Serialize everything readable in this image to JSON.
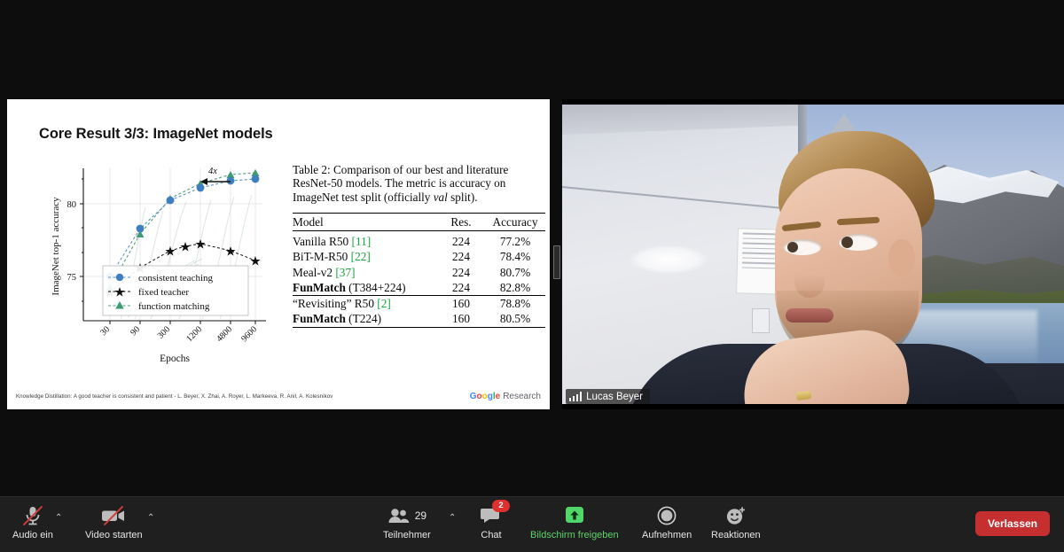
{
  "meeting": {
    "shared_screen_label": "shared-screen",
    "participant_name": "Lucas Beyer"
  },
  "slide": {
    "title": "Core Result 3/3: ImageNet models",
    "footer": "Knowledge Distillation:  A good teacher is consistent and patient - L. Beyer, X. Zhai, A. Royer, L. Markeeva, R. Anil, A. Kolesnikov",
    "logo": {
      "g": "G",
      "o1": "o",
      "o2": "o",
      "g2": "g",
      "l": "l",
      "e": "e",
      "research": "Research"
    }
  },
  "paper": {
    "caption_line1": "Table 2: Comparison of our best and literature",
    "caption_line2": "ResNet-50 models. The metric is accuracy on",
    "caption_line3a": "ImageNet test split (officially ",
    "caption_italic": "val",
    "caption_line3b": " split).",
    "columns": [
      "Model",
      "Res.",
      "Accuracy"
    ],
    "rows": [
      {
        "model": "Vanilla R50",
        "ref": "[11]",
        "res": "224",
        "acc": "77.2%",
        "bold": false
      },
      {
        "model": "BiT-M-R50",
        "ref": "[22]",
        "res": "224",
        "acc": "78.4%",
        "bold": false
      },
      {
        "model": "Meal-v2",
        "ref": "[37]",
        "res": "224",
        "acc": "80.7%",
        "bold": false
      },
      {
        "model": "FunMatch",
        "suffix": "(T384+224)",
        "ref": "",
        "res": "224",
        "acc": "82.8%",
        "bold": true
      }
    ],
    "rows2": [
      {
        "model": "“Revisiting” R50",
        "ref": "[2]",
        "res": "160",
        "acc": "78.8%",
        "bold": false
      },
      {
        "model": "FunMatch",
        "suffix": "(T224)",
        "ref": "",
        "res": "160",
        "acc": "80.5%",
        "bold": true
      }
    ]
  },
  "chart_data": {
    "type": "line",
    "title": "",
    "xlabel": "Epochs",
    "ylabel": "ImageNet top-1 accuracy",
    "x_tick_labels": [
      "30",
      "90",
      "300",
      "1200",
      "4800",
      "9600"
    ],
    "y_tick_labels": [
      "75",
      "80"
    ],
    "ylim": [
      73.2,
      83.6
    ],
    "xlog": true,
    "grid": true,
    "annotation": "4x",
    "legend_position": "lower-right",
    "categories": [
      30,
      90,
      300,
      1200,
      4800,
      9600
    ],
    "series": [
      {
        "name": "consistent teaching",
        "color": "#3f7fbf",
        "marker": "circle",
        "x": [
          30,
          90,
          300,
          1200,
          4800,
          9600
        ],
        "values": [
          75.0,
          78.3,
          80.2,
          81.9,
          82.4,
          82.5
        ]
      },
      {
        "name": "fixed teacher",
        "color": "#111111",
        "marker": "star",
        "x": [
          30,
          90,
          300,
          600,
          1200,
          4800,
          9600
        ],
        "values": [
          74.4,
          76.3,
          77.6,
          77.9,
          78.1,
          77.6,
          76.9
        ]
      },
      {
        "name": "function matching",
        "color": "#3f9b72",
        "marker": "triangle",
        "x": [
          30,
          90,
          300,
          1200,
          4800,
          9600
        ],
        "values": [
          74.4,
          78.0,
          80.4,
          82.2,
          82.9,
          83.0
        ]
      }
    ]
  },
  "toolbar": {
    "audio": {
      "label": "Audio ein",
      "icon": "microphone-muted-icon",
      "caret": "⌃"
    },
    "video": {
      "label": "Video starten",
      "icon": "camera-off-icon",
      "caret": "⌃"
    },
    "participants": {
      "label": "Teilnehmer",
      "count": "29",
      "icon": "participants-icon",
      "caret": "⌃"
    },
    "chat": {
      "label": "Chat",
      "badge": "2",
      "icon": "chat-bubble-icon"
    },
    "share": {
      "label": "Bildschirm freigeben",
      "icon": "share-screen-icon",
      "color": "#5bd46a"
    },
    "record": {
      "label": "Aufnehmen",
      "icon": "record-circle-icon"
    },
    "reactions": {
      "label": "Reaktionen",
      "icon": "smiley-plus-icon"
    },
    "leave": {
      "label": "Verlassen",
      "color": "#c62f2f"
    }
  }
}
